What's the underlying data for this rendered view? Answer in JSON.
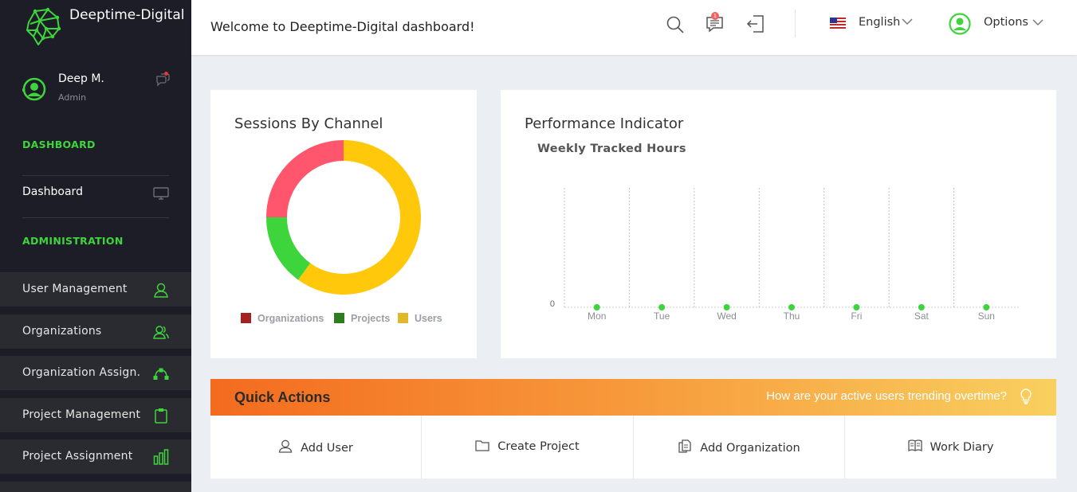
{
  "brand": {
    "name": "Deeptime-Digital",
    "logo_icon": "brain-network-icon",
    "accent": "#3ed43c"
  },
  "user": {
    "name": "Deep M.",
    "role": "Admin"
  },
  "sidebar": {
    "section_dashboard": "DASHBOARD",
    "dashboard_item": {
      "label": "Dashboard",
      "icon": "monitor-icon"
    },
    "section_admin": "ADMINISTRATION",
    "items": [
      {
        "label": "User Management",
        "icon": "user-icon"
      },
      {
        "label": "Organizations",
        "icon": "users-icon"
      },
      {
        "label": "Organization Assign.",
        "icon": "network-icon"
      },
      {
        "label": "Project Management",
        "icon": "clipboard-icon"
      },
      {
        "label": "Project Assignment",
        "icon": "bar-chart-icon"
      }
    ]
  },
  "header": {
    "welcome": "Welcome to Deeptime-Digital dashboard!",
    "notification_badge": "1",
    "language": "English",
    "options": "Options"
  },
  "sessions_card": {
    "title": "Sessions By Channel"
  },
  "performance_card": {
    "title": "Performance Indicator"
  },
  "chart_data": [
    {
      "type": "pie",
      "title": "Sessions By Channel",
      "categories": [
        "Organizations",
        "Projects",
        "Users"
      ],
      "values": [
        25,
        15,
        60
      ],
      "legend_colors": [
        "#a32121",
        "#2e7d1e",
        "#e0b92a"
      ],
      "slice_colors": [
        "#ff566d",
        "#3ed43c",
        "#ffc80a"
      ],
      "donut": true,
      "legend": "bottom"
    },
    {
      "type": "line",
      "title": "Weekly Tracked Hours",
      "categories": [
        "Mon",
        "Tue",
        "Wed",
        "Thu",
        "Fri",
        "Sat",
        "Sun"
      ],
      "series": [
        {
          "values": [
            0,
            0,
            0,
            0,
            0,
            0,
            0
          ],
          "color": "#3ed43c"
        }
      ],
      "y_ticks": [
        "0"
      ],
      "grid": "vertical dotted"
    }
  ],
  "quick_actions": {
    "title": "Quick Actions",
    "question": "How are your active users trending overtime?",
    "buttons": [
      {
        "label": "Add User",
        "icon": "user-outline-icon"
      },
      {
        "label": "Create Project",
        "icon": "folder-icon"
      },
      {
        "label": "Add Organization",
        "icon": "document-copy-icon"
      },
      {
        "label": "Work Diary",
        "icon": "book-icon"
      }
    ]
  }
}
